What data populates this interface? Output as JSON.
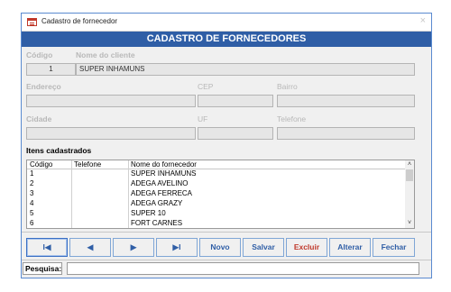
{
  "window": {
    "title": "Cadastro de fornecedor",
    "close_glyph": "×",
    "icon": "form-icon"
  },
  "header": {
    "title": "CADASTRO DE FORNECEDORES"
  },
  "form": {
    "codigo_label": "Código",
    "nome_label": "Nome do cliente",
    "codigo_value": "1",
    "nome_value": "SUPER INHAMUNS",
    "endereco_label": "Endereço",
    "endereco_value": "",
    "cep_label": "CEP",
    "cep_value": "",
    "bairro_label": "Bairro",
    "bairro_value": "",
    "cidade_label": "Cidade",
    "cidade_value": "",
    "uf_label": "UF",
    "uf_value": "",
    "telefone_label": "Telefone",
    "telefone_value": ""
  },
  "list": {
    "title": "Itens cadastrados",
    "columns": [
      "Código",
      "Telefone",
      "Nome do fornecedor"
    ],
    "rows": [
      {
        "codigo": "1",
        "telefone": "",
        "nome": "SUPER INHAMUNS"
      },
      {
        "codigo": "2",
        "telefone": "",
        "nome": "ADEGA AVELINO"
      },
      {
        "codigo": "3",
        "telefone": "",
        "nome": "ADEGA FERRECA"
      },
      {
        "codigo": "4",
        "telefone": "",
        "nome": "ADEGA GRAZY"
      },
      {
        "codigo": "5",
        "telefone": "",
        "nome": "SUPER 10"
      },
      {
        "codigo": "6",
        "telefone": "",
        "nome": "FORT CARNES"
      }
    ],
    "scroll_up": "˄",
    "scroll_down": "˅"
  },
  "buttons": {
    "first": "I◀",
    "prev": "◀",
    "next": "▶",
    "last": "▶I",
    "novo": "Novo",
    "salvar": "Salvar",
    "excluir": "Excluir",
    "alterar": "Alterar",
    "fechar": "Fechar"
  },
  "search": {
    "label": "Pesquisa:",
    "value": ""
  },
  "colors": {
    "accent": "#2f5ea6",
    "danger": "#c0392b"
  }
}
